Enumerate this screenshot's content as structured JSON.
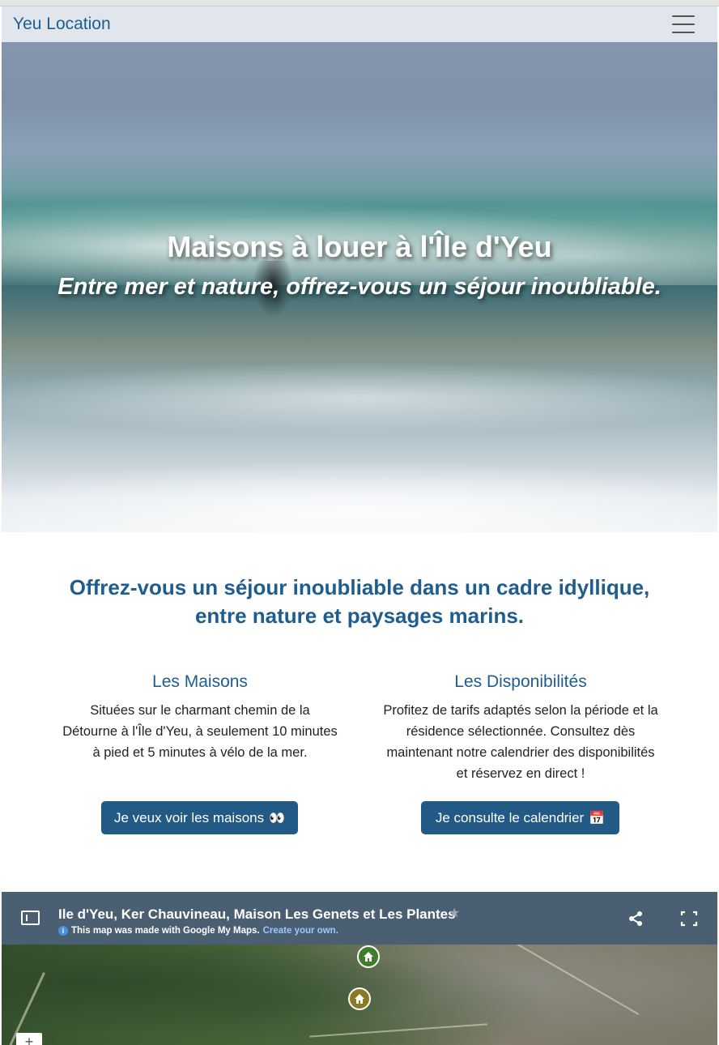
{
  "navbar": {
    "brand": "Yeu Location",
    "menu_icon": "hamburger-menu-icon"
  },
  "hero": {
    "title": "Maisons à louer à l'Île d'Yeu",
    "subtitle": "Entre mer et nature, offrez-vous un séjour inoubliable."
  },
  "intro": {
    "line1": "Offrez-vous un séjour inoubliable dans un cadre idyllique,",
    "line2": "entre nature et paysages marins."
  },
  "sections": [
    {
      "title": "Les Maisons",
      "text": "Situées sur le charmant chemin de la Détourne à l'Île d'Yeu, à seulement 10 minutes à pied et 5 minutes à vélo de la mer.",
      "button_label": "Je veux voir les maisons",
      "button_emoji": "👀"
    },
    {
      "title": "Les Disponibilités",
      "text": "Profitez de tarifs adaptés selon la période et la résidence sélectionnée. Consultez dès maintenant notre calendrier des disponibilités et réservez en direct !",
      "button_label": "Je consulte le calendrier",
      "button_emoji": "📅"
    }
  ],
  "map": {
    "title": "Ile d'Yeu, Ker Chauvineau, Maison Les Genets et Les Plantes",
    "info_text": "This map was made with Google My Maps.",
    "info_link": "Create your own.",
    "zoom_in": "+",
    "icons": [
      "sidebar-toggle-icon",
      "star-icon",
      "share-icon",
      "fullscreen-icon",
      "house-marker-icon"
    ]
  },
  "colors": {
    "accent": "#1f5d8f",
    "button": "#235a85",
    "navbar": "#e1e5ec",
    "map_header": "#4b5f72"
  }
}
